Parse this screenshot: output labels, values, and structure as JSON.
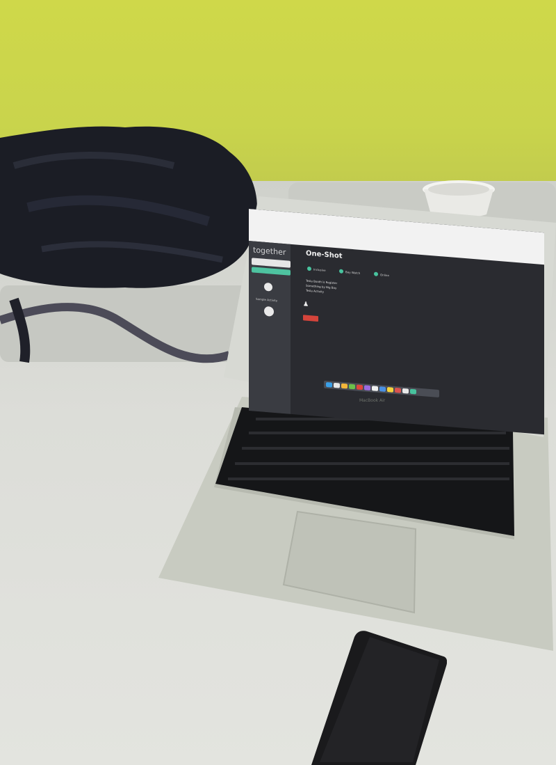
{
  "scene": {
    "description_objects": [
      "wall",
      "table",
      "backpack",
      "paper-cup",
      "laptop",
      "smartphone"
    ]
  },
  "laptop": {
    "model_label": "MacBook Air"
  },
  "app": {
    "logo": "together",
    "title": "One-Shot",
    "tags": [
      "Inclusive",
      "Bay Watch",
      "Online"
    ],
    "lines": [
      "Tesla Booth is Register",
      "Something by Big Bay",
      "Tesla Activity"
    ],
    "side_caption": "Sample Activity"
  },
  "colors": {
    "wall": "#cbd64c",
    "screen_bg": "#2a2b30",
    "sidebar": "#3a3c42",
    "accent": "#4ec3a0",
    "button_red": "#d4443b"
  }
}
